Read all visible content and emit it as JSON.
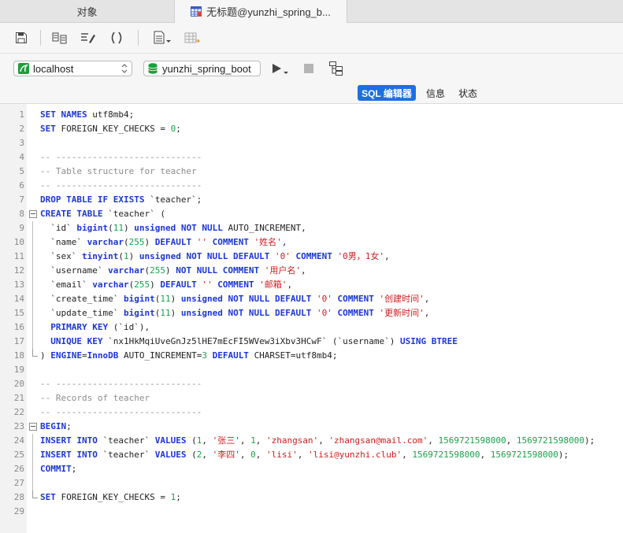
{
  "tabs": {
    "objects_label": "对象",
    "query_label": "无标题@yunzhi_spring_b..."
  },
  "connection": {
    "host": "localhost",
    "database": "yunzhi_spring_boot"
  },
  "subtabs": {
    "sql_editor": "SQL 编辑器",
    "info": "信息",
    "status": "状态"
  },
  "editor": {
    "lines": [
      {
        "num": "1",
        "tokens": [
          [
            "k",
            "SET NAMES "
          ],
          [
            "t",
            "utf8mb4;"
          ]
        ]
      },
      {
        "num": "2",
        "tokens": [
          [
            "k",
            "SET "
          ],
          [
            "t",
            "FOREIGN_KEY_CHECKS = "
          ],
          [
            "n",
            "0"
          ],
          [
            "t",
            ";"
          ]
        ]
      },
      {
        "num": "3",
        "tokens": []
      },
      {
        "num": "4",
        "tokens": [
          [
            "c",
            "-- ----------------------------"
          ]
        ]
      },
      {
        "num": "5",
        "tokens": [
          [
            "c",
            "-- Table structure for teacher"
          ]
        ]
      },
      {
        "num": "6",
        "tokens": [
          [
            "c",
            "-- ----------------------------"
          ]
        ]
      },
      {
        "num": "7",
        "tokens": [
          [
            "k",
            "DROP TABLE IF EXISTS "
          ],
          [
            "t",
            "`teacher`;"
          ]
        ]
      },
      {
        "num": "8",
        "tokens": [
          [
            "k",
            "CREATE TABLE "
          ],
          [
            "t",
            "`teacher` ("
          ]
        ]
      },
      {
        "num": "9",
        "tokens": [
          [
            "t",
            "  `id` "
          ],
          [
            "k",
            "bigint"
          ],
          [
            "t",
            "("
          ],
          [
            "n",
            "11"
          ],
          [
            "t",
            ") "
          ],
          [
            "k",
            "unsigned NOT NULL "
          ],
          [
            "t",
            "AUTO_INCREMENT,"
          ]
        ]
      },
      {
        "num": "10",
        "tokens": [
          [
            "t",
            "  `name` "
          ],
          [
            "k",
            "varchar"
          ],
          [
            "t",
            "("
          ],
          [
            "n",
            "255"
          ],
          [
            "t",
            ") "
          ],
          [
            "k",
            "DEFAULT "
          ],
          [
            "s",
            "''"
          ],
          [
            "k",
            " COMMENT "
          ],
          [
            "s",
            "'姓名'"
          ],
          [
            "t",
            ","
          ]
        ]
      },
      {
        "num": "11",
        "tokens": [
          [
            "t",
            "  `sex` "
          ],
          [
            "k",
            "tinyint"
          ],
          [
            "t",
            "("
          ],
          [
            "n",
            "1"
          ],
          [
            "t",
            ") "
          ],
          [
            "k",
            "unsigned NOT NULL DEFAULT "
          ],
          [
            "s",
            "'0'"
          ],
          [
            "k",
            " COMMENT "
          ],
          [
            "s",
            "'0男，1女'"
          ],
          [
            "t",
            ","
          ]
        ]
      },
      {
        "num": "12",
        "tokens": [
          [
            "t",
            "  `username` "
          ],
          [
            "k",
            "varchar"
          ],
          [
            "t",
            "("
          ],
          [
            "n",
            "255"
          ],
          [
            "t",
            ") "
          ],
          [
            "k",
            "NOT NULL COMMENT "
          ],
          [
            "s",
            "'用户名'"
          ],
          [
            "t",
            ","
          ]
        ]
      },
      {
        "num": "13",
        "tokens": [
          [
            "t",
            "  `email` "
          ],
          [
            "k",
            "varchar"
          ],
          [
            "t",
            "("
          ],
          [
            "n",
            "255"
          ],
          [
            "t",
            ") "
          ],
          [
            "k",
            "DEFAULT "
          ],
          [
            "s",
            "''"
          ],
          [
            "k",
            " COMMENT "
          ],
          [
            "s",
            "'邮箱'"
          ],
          [
            "t",
            ","
          ]
        ]
      },
      {
        "num": "14",
        "tokens": [
          [
            "t",
            "  `create_time` "
          ],
          [
            "k",
            "bigint"
          ],
          [
            "t",
            "("
          ],
          [
            "n",
            "11"
          ],
          [
            "t",
            ") "
          ],
          [
            "k",
            "unsigned NOT NULL DEFAULT "
          ],
          [
            "s",
            "'0'"
          ],
          [
            "k",
            " COMMENT "
          ],
          [
            "s",
            "'创建时间'"
          ],
          [
            "t",
            ","
          ]
        ]
      },
      {
        "num": "15",
        "tokens": [
          [
            "t",
            "  `update_time` "
          ],
          [
            "k",
            "bigint"
          ],
          [
            "t",
            "("
          ],
          [
            "n",
            "11"
          ],
          [
            "t",
            ") "
          ],
          [
            "k",
            "unsigned NOT NULL DEFAULT "
          ],
          [
            "s",
            "'0'"
          ],
          [
            "k",
            " COMMENT "
          ],
          [
            "s",
            "'更新时间'"
          ],
          [
            "t",
            ","
          ]
        ]
      },
      {
        "num": "16",
        "tokens": [
          [
            "t",
            "  "
          ],
          [
            "k",
            "PRIMARY KEY "
          ],
          [
            "t",
            "(`id`),"
          ]
        ]
      },
      {
        "num": "17",
        "tokens": [
          [
            "t",
            "  "
          ],
          [
            "k",
            "UNIQUE KEY "
          ],
          [
            "t",
            "`nx1HkMqiUveGnJz5lHE7mEcFI5WVew3iXbv3HCwF` (`username`) "
          ],
          [
            "k",
            "USING BTREE"
          ]
        ]
      },
      {
        "num": "18",
        "tokens": [
          [
            "t",
            ") "
          ],
          [
            "k",
            "ENGINE"
          ],
          [
            "t",
            "="
          ],
          [
            "k",
            "InnoDB "
          ],
          [
            "t",
            "AUTO_INCREMENT="
          ],
          [
            "n",
            "3"
          ],
          [
            "k",
            " DEFAULT "
          ],
          [
            "t",
            "CHARSET=utf8mb4;"
          ]
        ]
      },
      {
        "num": "19",
        "tokens": []
      },
      {
        "num": "20",
        "tokens": [
          [
            "c",
            "-- ----------------------------"
          ]
        ]
      },
      {
        "num": "21",
        "tokens": [
          [
            "c",
            "-- Records of teacher"
          ]
        ]
      },
      {
        "num": "22",
        "tokens": [
          [
            "c",
            "-- ----------------------------"
          ]
        ]
      },
      {
        "num": "23",
        "tokens": [
          [
            "k",
            "BEGIN"
          ],
          [
            "t",
            ";"
          ]
        ]
      },
      {
        "num": "24",
        "tokens": [
          [
            "k",
            "INSERT INTO "
          ],
          [
            "t",
            "`teacher` "
          ],
          [
            "k",
            "VALUES "
          ],
          [
            "t",
            "("
          ],
          [
            "n",
            "1"
          ],
          [
            "t",
            ", "
          ],
          [
            "s",
            "'张三'"
          ],
          [
            "t",
            ", "
          ],
          [
            "n",
            "1"
          ],
          [
            "t",
            ", "
          ],
          [
            "s",
            "'zhangsan'"
          ],
          [
            "t",
            ", "
          ],
          [
            "s",
            "'zhangsan@mail.com'"
          ],
          [
            "t",
            ", "
          ],
          [
            "n",
            "1569721598000"
          ],
          [
            "t",
            ", "
          ],
          [
            "n",
            "1569721598000"
          ],
          [
            "t",
            ");"
          ]
        ]
      },
      {
        "num": "25",
        "tokens": [
          [
            "k",
            "INSERT INTO "
          ],
          [
            "t",
            "`teacher` "
          ],
          [
            "k",
            "VALUES "
          ],
          [
            "t",
            "("
          ],
          [
            "n",
            "2"
          ],
          [
            "t",
            ", "
          ],
          [
            "s",
            "'李四'"
          ],
          [
            "t",
            ", "
          ],
          [
            "n",
            "0"
          ],
          [
            "t",
            ", "
          ],
          [
            "s",
            "'lisi'"
          ],
          [
            "t",
            ", "
          ],
          [
            "s",
            "'lisi@yunzhi.club'"
          ],
          [
            "t",
            ", "
          ],
          [
            "n",
            "1569721598000"
          ],
          [
            "t",
            ", "
          ],
          [
            "n",
            "1569721598000"
          ],
          [
            "t",
            ");"
          ]
        ]
      },
      {
        "num": "26",
        "tokens": [
          [
            "k",
            "COMMIT"
          ],
          [
            "t",
            ";"
          ]
        ]
      },
      {
        "num": "27",
        "tokens": []
      },
      {
        "num": "28",
        "tokens": [
          [
            "k",
            "SET "
          ],
          [
            "t",
            "FOREIGN_KEY_CHECKS = "
          ],
          [
            "n",
            "1"
          ],
          [
            "t",
            ";"
          ]
        ]
      },
      {
        "num": "29",
        "tokens": []
      }
    ]
  }
}
